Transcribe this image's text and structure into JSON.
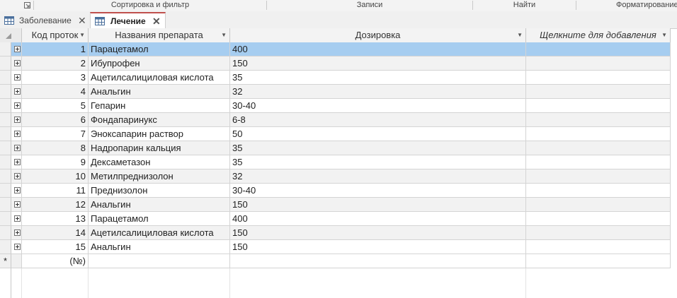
{
  "ribbon": {
    "groups": [
      "Сортировка и фильтр",
      "Записи",
      "Найти",
      "Форматирование"
    ]
  },
  "tabs": [
    {
      "label": "Заболевание",
      "active": false
    },
    {
      "label": "Лечение",
      "active": true
    }
  ],
  "table": {
    "columns": [
      "Код проток",
      "Названия препарата",
      "Дозировка",
      "Щелкните для добавления"
    ],
    "rows": [
      {
        "id": "1",
        "name": "Парацетамол",
        "dose": "400"
      },
      {
        "id": "2",
        "name": "Ибупрофен",
        "dose": "150"
      },
      {
        "id": "3",
        "name": "Ацетилсалициловая кислота",
        "dose": "35"
      },
      {
        "id": "4",
        "name": "Анальгин",
        "dose": "32"
      },
      {
        "id": "5",
        "name": "Гепарин",
        "dose": "30-40"
      },
      {
        "id": "6",
        "name": "Фондапаринукс",
        "dose": "6-8"
      },
      {
        "id": "7",
        "name": "Эноксапарин раствор",
        "dose": "50"
      },
      {
        "id": "8",
        "name": "Надропарин кальция",
        "dose": "35"
      },
      {
        "id": "9",
        "name": "Дексаметазон",
        "dose": "35"
      },
      {
        "id": "10",
        "name": "Метилпреднизолон",
        "dose": "32"
      },
      {
        "id": "11",
        "name": "Преднизолон",
        "dose": "30-40"
      },
      {
        "id": "12",
        "name": "Анальгин",
        "dose": "150"
      },
      {
        "id": "13",
        "name": "Парацетамол",
        "dose": "400"
      },
      {
        "id": "14",
        "name": "Ацетилсалициловая кислота",
        "dose": "150"
      },
      {
        "id": "15",
        "name": "Анальгин",
        "dose": "150"
      }
    ],
    "new_record_placeholder": "(№)",
    "selected_row": 0
  },
  "icons": {
    "select_all": "select-all-icon",
    "new_record": "new-record-asterisk-icon",
    "expand": "expand-plus-icon",
    "table": "table-icon",
    "close": "close-icon",
    "dropdown": "dropdown-arrow-icon"
  },
  "colors": {
    "selected_row": "#a6cdf0",
    "active_tab_accent": "#c0504d",
    "alt_row": "#f2f2f2"
  }
}
